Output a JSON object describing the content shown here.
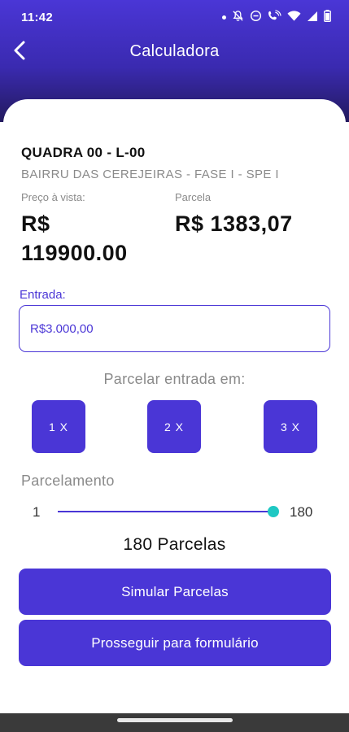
{
  "status_bar": {
    "time": "11:42",
    "icons": [
      "notification-dot-icon",
      "bell-off-icon",
      "do-not-disturb-icon",
      "wifi-call-icon",
      "wifi-icon",
      "signal-icon",
      "battery-icon"
    ]
  },
  "app_bar": {
    "title": "Calculadora",
    "back_icon": "chevron-left-icon"
  },
  "lot": {
    "title": "QUADRA 00 - L-00",
    "subtitle": "BAIRRU DAS CEREJEIRAS - FASE I - SPE I"
  },
  "pricing": {
    "cash_label": "Preço à vista:",
    "cash_currency": "R$",
    "cash_value": "119900.00",
    "installment_label": "Parcela",
    "installment_value": "R$ 1383,07"
  },
  "down_payment": {
    "label": "Entrada:",
    "value": "R$3.000,00",
    "placeholder": ""
  },
  "split_down_payment": {
    "label": "Parcelar entrada em:",
    "options": [
      {
        "label": "1 X"
      },
      {
        "label": "2 X"
      },
      {
        "label": "3 X"
      }
    ]
  },
  "installments": {
    "label": "Parcelamento",
    "min": "1",
    "max": "180",
    "value": 180,
    "count_text": "180 Parcelas"
  },
  "actions": {
    "simulate": "Simular Parcelas",
    "proceed": "Prosseguir para formulário"
  },
  "colors": {
    "primary": "#4a36d6",
    "header_dark": "#231a5e",
    "slider_thumb": "#1fc8c3",
    "muted_text": "#8a8a8a",
    "nav_bar": "#3a3a3a"
  }
}
